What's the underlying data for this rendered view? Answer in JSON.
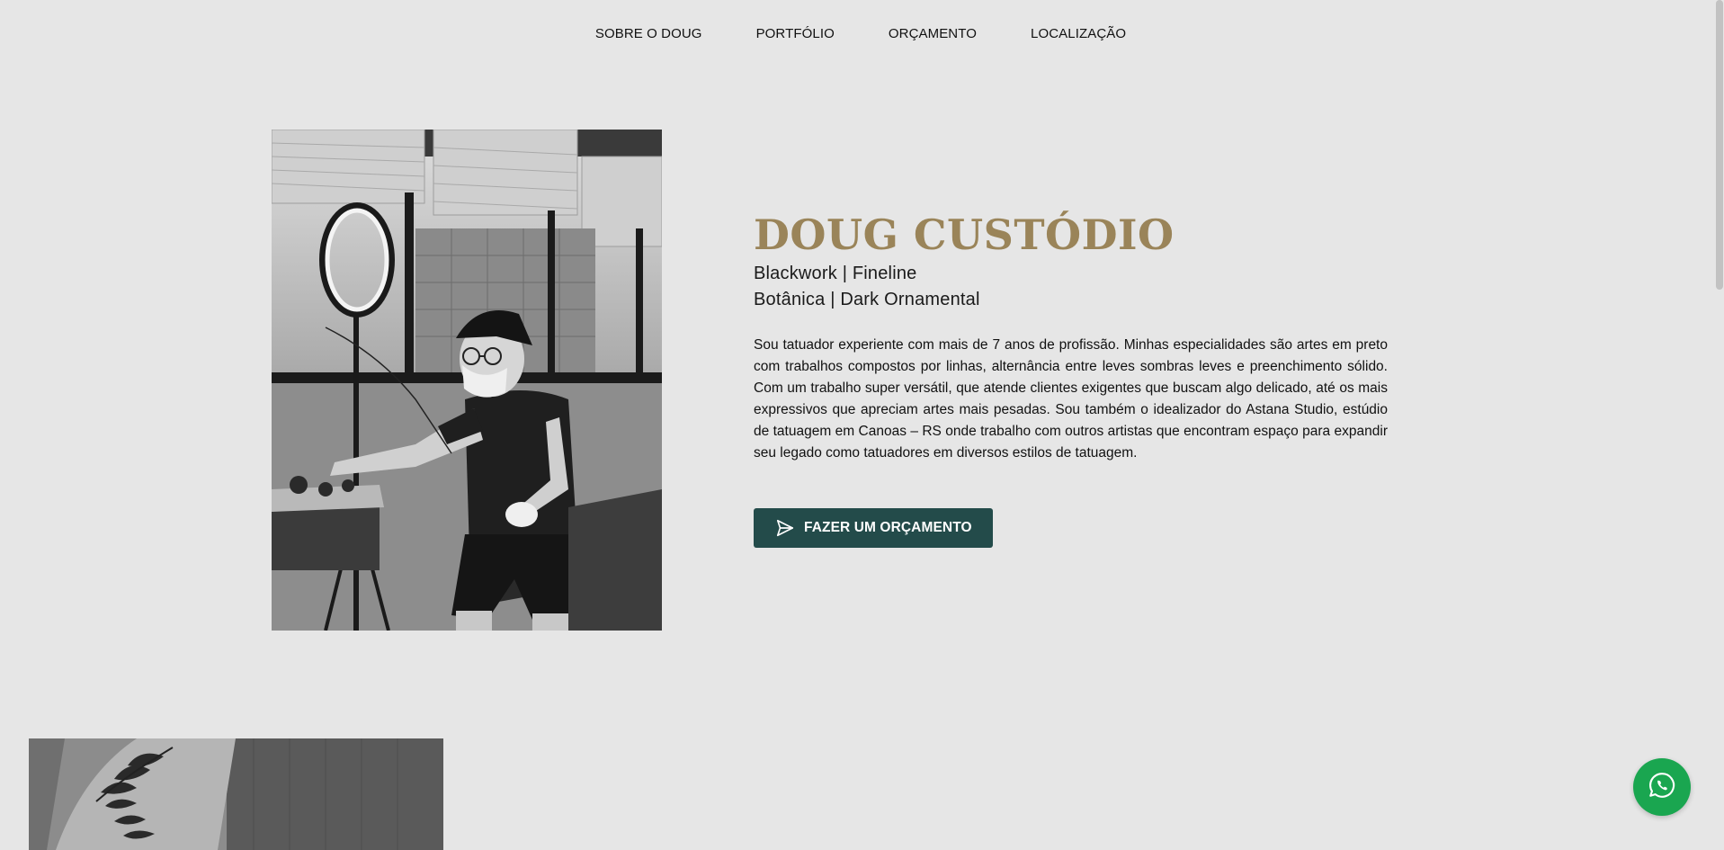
{
  "nav": {
    "items": [
      {
        "label": "SOBRE O DOUG"
      },
      {
        "label": "PORTFÓLIO"
      },
      {
        "label": "ORÇAMENTO"
      },
      {
        "label": "LOCALIZAÇÃO"
      }
    ]
  },
  "hero": {
    "name": "DOUG CUSTÓDIO",
    "styles_line1": "Blackwork | Fineline",
    "styles_line2": "Botânica | Dark Ornamental",
    "bio": "Sou tatuador experiente com mais de 7 anos de profissão. Minhas especialidades são artes em preto com trabalhos compostos por linhas, alternância entre leves sombras leves e preenchimento sólido. Com um trabalho super versátil, que atende clientes exigentes que buscam algo delicado, até os mais expressivos que apreciam artes mais pesadas. Sou também o idealizador do Astana Studio, estúdio de tatuagem em Canoas – RS onde trabalho com outros artistas que encontram espaço para expandir seu legado como tatuadores em diversos estilos de tatuagem.",
    "cta_label": "FAZER UM ORÇAMENTO",
    "cta_icon": "send-icon"
  },
  "floating": {
    "whatsapp_icon": "whatsapp-icon"
  },
  "colors": {
    "background": "#e6e6e6",
    "name_gold": "#9a8459",
    "cta_green": "#234b4a",
    "whatsapp_green": "#1aa650"
  }
}
